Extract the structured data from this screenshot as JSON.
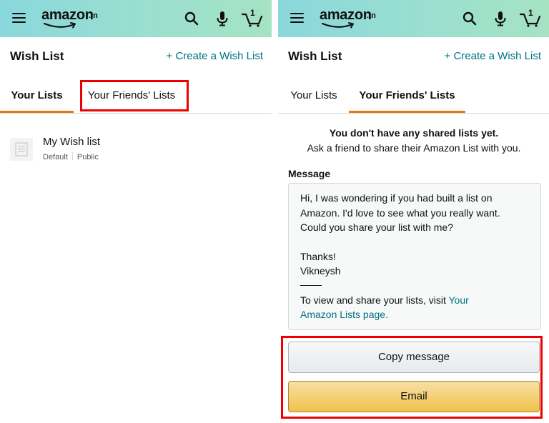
{
  "brand": {
    "logo_text": "amazon",
    "logo_suffix": ".in"
  },
  "header": {
    "cart_count": "1"
  },
  "page": {
    "title": "Wish List",
    "create_link": "+ Create a Wish List"
  },
  "tabs": {
    "yours": "Your Lists",
    "friends": "Your Friends' Lists"
  },
  "left": {
    "active_tab": "yours",
    "lists": [
      {
        "name": "My Wish list",
        "tag": "Default",
        "privacy": "Public"
      }
    ]
  },
  "right": {
    "active_tab": "friends",
    "empty_title": "You don't have any shared lists yet.",
    "empty_subtitle": "Ask a friend to share their Amazon List with you.",
    "message_label": "Message",
    "message": {
      "line1": "Hi, I was wondering if you had built a list on",
      "line2": "Amazon. I'd love to see what you really want.",
      "line3": "Could you share your list with me?",
      "thanks": "Thanks!",
      "signature": "Vikneysh",
      "view_prefix": "To view and share your lists, visit",
      "view_link_a": "Your",
      "view_link_b": "Amazon Lists page."
    },
    "copy_button": "Copy message",
    "email_button": "Email"
  },
  "colors": {
    "header_gradient": [
      "#8ad8dc",
      "#a6e3c3"
    ],
    "link": "#007185",
    "tab_underline": "#e47911",
    "highlight": "#ee0000",
    "email_button": "#f0c14b"
  }
}
